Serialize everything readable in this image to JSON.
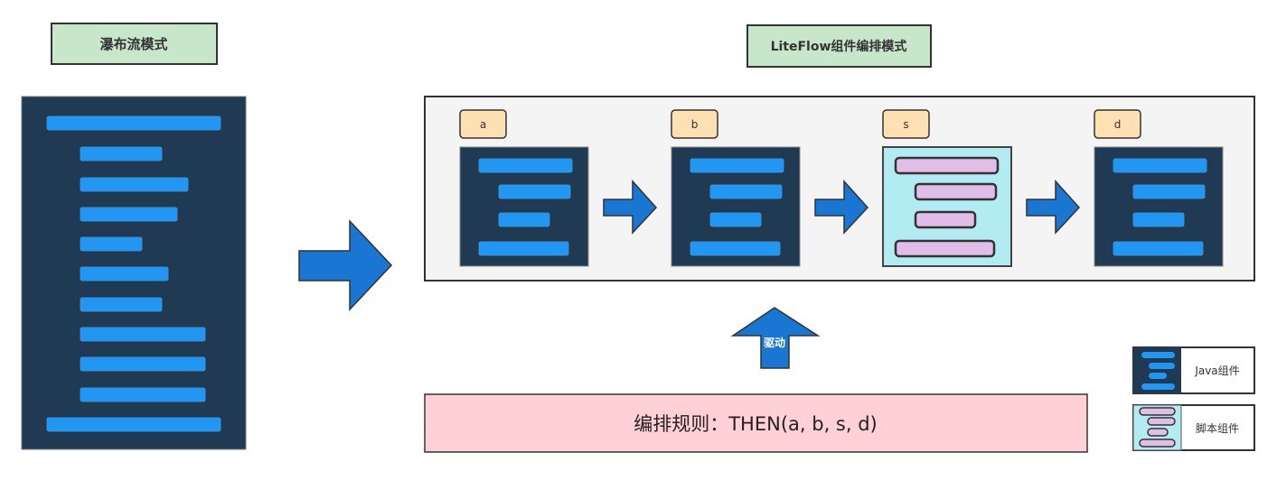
{
  "left": {
    "title": "瀑布流模式"
  },
  "right": {
    "title": "LiteFlow组件编排模式"
  },
  "components": [
    {
      "label": "a",
      "type": "java"
    },
    {
      "label": "b",
      "type": "java"
    },
    {
      "label": "s",
      "type": "script"
    },
    {
      "label": "d",
      "type": "java"
    }
  ],
  "drive_label": "驱动",
  "rule": {
    "text": "编排规则：THEN(a, b, s, d)"
  },
  "legend": {
    "java": "Java组件",
    "script": "脚本组件"
  },
  "colors": {
    "title_bg": "#c8e6c9",
    "java_bg": "#1f3a52",
    "java_bar": "#2196f3",
    "script_bg": "#b2ebf2",
    "script_bar": "#e1bee7",
    "label_bg": "#ffe0b2",
    "arrow": "#1976d2",
    "container_bg": "#f4f4f4",
    "rule_bg": "#ffd0d6"
  }
}
